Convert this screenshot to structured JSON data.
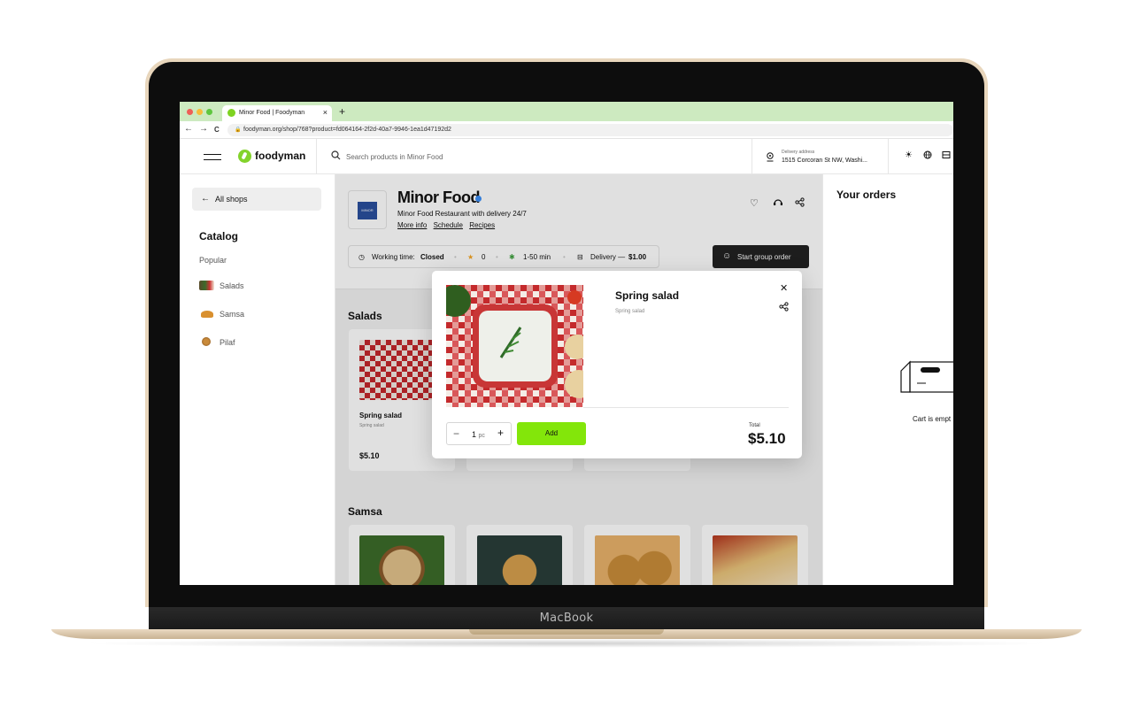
{
  "device": {
    "brand_label": "MacBook"
  },
  "browser": {
    "tab_title": "Minor Food | Foodyman",
    "tab_close": "×",
    "new_tab": "+",
    "url": "foodyman.org/shop/768?product=fd064164-2f2d-40a7-9946-1ea1d47192d2",
    "nav_back": "←",
    "nav_forward": "→",
    "nav_reload": "C"
  },
  "header": {
    "logo_text": "foodyman",
    "search_placeholder": "Search products in Minor Food",
    "delivery_label": "Delivery address",
    "delivery_value": "1515 Corcoran St NW, Washi...",
    "icons": [
      "sun-icon",
      "globe-icon",
      "layout-icon"
    ]
  },
  "sidebar": {
    "all_shops": "All shops",
    "catalog_title": "Catalog",
    "items": [
      {
        "label": "Popular"
      },
      {
        "label": "Salads"
      },
      {
        "label": "Samsa"
      },
      {
        "label": "Pilaf"
      }
    ]
  },
  "shop": {
    "name": "Minor Food",
    "description": "Minor Food Restaurant with delivery 24/7",
    "links": [
      "More info",
      "Schedule",
      "Recipes"
    ],
    "working_time_label": "Working time:",
    "working_time_value": "Closed",
    "rating": "0",
    "delivery_time": "1-50 min",
    "delivery_label": "Delivery —",
    "delivery_price": "$1.00",
    "group_order": "Start group order"
  },
  "sections": [
    {
      "title": "Salads",
      "cards": [
        {
          "name": "Spring salad",
          "subtitle": "Spring salad",
          "price": "$5.10"
        }
      ]
    },
    {
      "title": "Samsa"
    }
  ],
  "orders": {
    "title": "Your orders",
    "empty_text": "Cart is empt"
  },
  "modal": {
    "product_name": "Spring salad",
    "product_subtitle": "Spring salad",
    "quantity": "1",
    "quantity_unit": "pc",
    "add_label": "Add",
    "total_label": "Total",
    "total_value": "$5.10"
  },
  "colors": {
    "brand_green": "#83d32b",
    "add_button": "#83e60a",
    "tab_bar": "#cdeac0",
    "verified_badge": "#3b8ff7"
  }
}
